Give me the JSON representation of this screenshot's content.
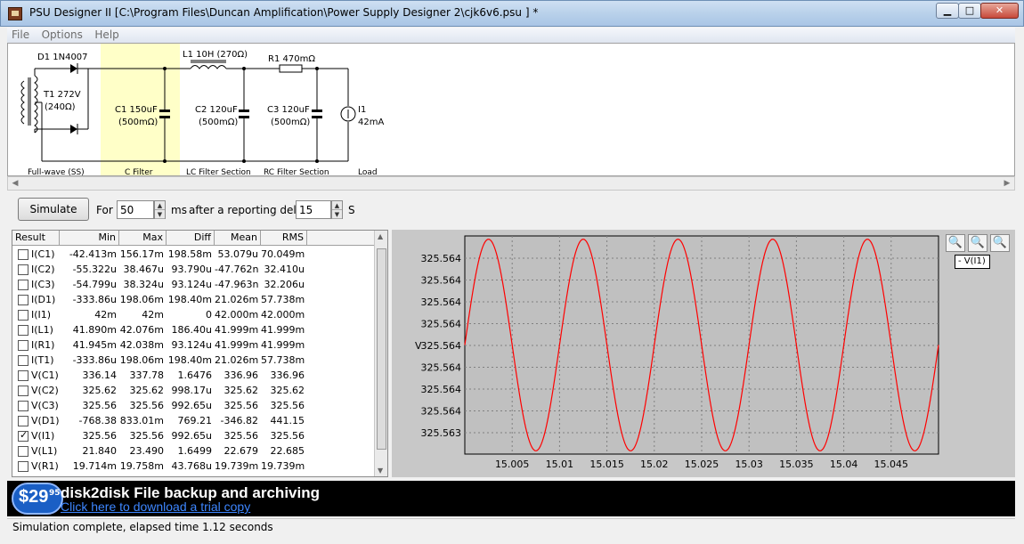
{
  "window": {
    "title": "PSU Designer II  [C:\\Program Files\\Duncan Amplification\\Power Supply Designer 2\\cjk6v6.psu ] *",
    "min_glyph": "▁",
    "max_glyph": "□",
    "close_glyph": "✕"
  },
  "menu": [
    "File",
    "Options",
    "Help"
  ],
  "schematic": {
    "d1": "D1 1N4007",
    "t1_a": "T1 272V",
    "t1_b": "(240Ω)",
    "c1_a": "C1 150uF",
    "c1_b": "(500mΩ)",
    "l1": "L1 10H (270Ω)",
    "c2_a": "C2 120uF",
    "c2_b": "(500mΩ)",
    "r1": "R1 470mΩ",
    "c3_a": "C3 120uF",
    "c3_b": "(500mΩ)",
    "i1_a": "I1",
    "i1_b": "42mA",
    "sections": [
      "Full-wave (SS)",
      "C Filter",
      "LC Filter Section",
      "RC Filter Section",
      "Load"
    ],
    "highlight_color": "#ffffc8"
  },
  "controls": {
    "simulate": "Simulate",
    "for_label": "For",
    "duration": "50",
    "ms_label": "ms",
    "delay_label": "after a reporting delay of",
    "delay": "15",
    "s_label": "S"
  },
  "results": {
    "headers": [
      "Result",
      "Min",
      "Max",
      "Diff",
      "Mean",
      "RMS"
    ],
    "rows": [
      {
        "name": "I(C1)",
        "checked": false,
        "min": "-42.413m",
        "max": "156.17m",
        "diff": "198.58m",
        "mean": "53.079u",
        "rms": "70.049m"
      },
      {
        "name": "I(C2)",
        "checked": false,
        "min": "-55.322u",
        "max": "38.467u",
        "diff": "93.790u",
        "mean": "-47.762n",
        "rms": "32.410u"
      },
      {
        "name": "I(C3)",
        "checked": false,
        "min": "-54.799u",
        "max": "38.324u",
        "diff": "93.124u",
        "mean": "-47.963n",
        "rms": "32.206u"
      },
      {
        "name": "I(D1)",
        "checked": false,
        "min": "-333.86u",
        "max": "198.06m",
        "diff": "198.40m",
        "mean": "21.026m",
        "rms": "57.738m"
      },
      {
        "name": "I(I1)",
        "checked": false,
        "min": "42m",
        "max": "42m",
        "diff": "0",
        "mean": "42.000m",
        "rms": "42.000m"
      },
      {
        "name": "I(L1)",
        "checked": false,
        "min": "41.890m",
        "max": "42.076m",
        "diff": "186.40u",
        "mean": "41.999m",
        "rms": "41.999m"
      },
      {
        "name": "I(R1)",
        "checked": false,
        "min": "41.945m",
        "max": "42.038m",
        "diff": "93.124u",
        "mean": "41.999m",
        "rms": "41.999m"
      },
      {
        "name": "I(T1)",
        "checked": false,
        "min": "-333.86u",
        "max": "198.06m",
        "diff": "198.40m",
        "mean": "21.026m",
        "rms": "57.738m"
      },
      {
        "name": "V(C1)",
        "checked": false,
        "min": "336.14",
        "max": "337.78",
        "diff": "1.6476",
        "mean": "336.96",
        "rms": "336.96"
      },
      {
        "name": "V(C2)",
        "checked": false,
        "min": "325.62",
        "max": "325.62",
        "diff": "998.17u",
        "mean": "325.62",
        "rms": "325.62"
      },
      {
        "name": "V(C3)",
        "checked": false,
        "min": "325.56",
        "max": "325.56",
        "diff": "992.65u",
        "mean": "325.56",
        "rms": "325.56"
      },
      {
        "name": "V(D1)",
        "checked": false,
        "min": "-768.38",
        "max": "833.01m",
        "diff": "769.21",
        "mean": "-346.82",
        "rms": "441.15"
      },
      {
        "name": "V(I1)",
        "checked": true,
        "min": "325.56",
        "max": "325.56",
        "diff": "992.65u",
        "mean": "325.56",
        "rms": "325.56"
      },
      {
        "name": "V(L1)",
        "checked": false,
        "min": "21.840",
        "max": "23.490",
        "diff": "1.6499",
        "mean": "22.679",
        "rms": "22.685"
      },
      {
        "name": "V(R1)",
        "checked": false,
        "min": "19.714m",
        "max": "19.758m",
        "diff": "43.768u",
        "mean": "19.739m",
        "rms": "19.739m"
      }
    ]
  },
  "legend": "- V(I1)",
  "chart_data": {
    "type": "line",
    "ylabel": "V",
    "y_tick_labels": [
      "325.564",
      "325.564",
      "325.564",
      "325.564",
      "325.564",
      "325.564",
      "325.564",
      "325.564",
      "325.563"
    ],
    "x_ticks": [
      15.005,
      15.01,
      15.015,
      15.02,
      15.025,
      15.03,
      15.035,
      15.04,
      15.045
    ],
    "x_tick_labels": [
      "15.005",
      "15.01",
      "15.015",
      "15.02",
      "15.025",
      "15.03",
      "15.035",
      "15.04",
      "15.045"
    ],
    "xlim": [
      15.0,
      15.05
    ],
    "ylim": [
      -1,
      1
    ],
    "series": [
      {
        "color": "#ff0000",
        "frequency_hz": 100,
        "phase_cycles": 0.0,
        "x_start": 15.0,
        "x_end": 15.05
      }
    ],
    "grid": true,
    "plot_bg": "#c0c0c0"
  },
  "banner": {
    "price": "$29",
    "cents": "95",
    "headline": "disk2disk File backup and archiving",
    "link": "Click here to download a trial copy"
  },
  "status": "Simulation complete, elapsed time 1.12 seconds"
}
